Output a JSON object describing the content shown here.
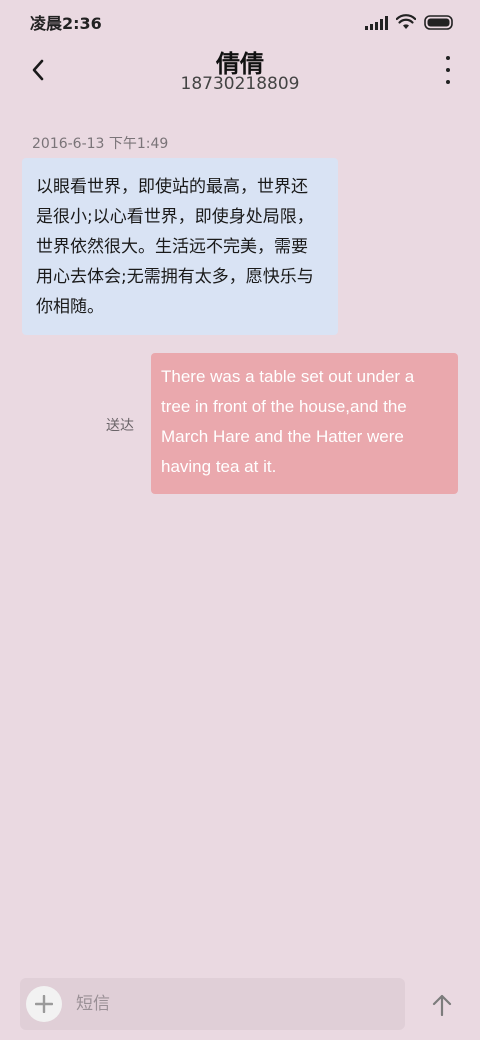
{
  "status_bar": {
    "time": "凌晨2:36",
    "icons": [
      "signal-icon",
      "wifi-icon",
      "battery-icon"
    ]
  },
  "header": {
    "contact_name": "倩倩",
    "phone_number": "18730218809",
    "back_icon": "chevron-left-icon",
    "more_icon": "more-vertical-icon"
  },
  "conversation": {
    "timestamp": "2016-6-13 下午1:49",
    "incoming_message": "以眼看世界，即使站的最高，世界还是很小;以心看世界，即使身处局限，世界依然很大。生活远不完美，需要用心去体会;无需拥有太多，愿快乐与你相随。",
    "outgoing_status": "送达",
    "outgoing_message": "There was a table set out under a tree in front of the house,and the March Hare and the Hatter were having tea at it."
  },
  "composer": {
    "placeholder": "短信",
    "value": "",
    "add_icon": "plus-icon",
    "send_icon": "arrow-up-icon"
  },
  "colors": {
    "background": "#ead9e1",
    "incoming_bubble": "#d9e3f4",
    "outgoing_bubble": "#eaa8ad",
    "composer_bg": "#e0cfd7"
  }
}
